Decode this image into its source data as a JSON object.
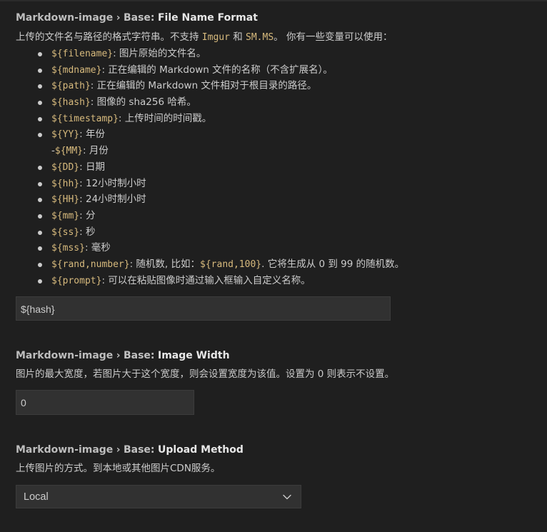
{
  "settings": [
    {
      "category": "Markdown-image",
      "separator": "›",
      "group": "Base:",
      "name": "File Name Format",
      "description_parts": [
        "上传的文件名与路径的格式字符串。不支持 ",
        "Imgur",
        " 和 ",
        "SM.MS",
        "。 你有一些变量可以使用："
      ],
      "variables": [
        {
          "code": "${filename}",
          "text": ": 图片原始的文件名。"
        },
        {
          "code": "${mdname}",
          "text": ": 正在编辑的 Markdown 文件的名称（不含扩展名）。"
        },
        {
          "code": "${path}",
          "text": ": 正在编辑的 Markdown 文件相对于根目录的路径。"
        },
        {
          "code": "${hash}",
          "text": ": 图像的 sha256 哈希。"
        },
        {
          "code": "${timestamp}",
          "text": ": 上传时间的时间戳。"
        },
        {
          "code": "${YY}",
          "text": ": 年份"
        },
        {
          "prefix": "-",
          "code": "${MM}",
          "text": ": 月份",
          "no_bullet": true
        },
        {
          "code": "${DD}",
          "text": ": 日期"
        },
        {
          "code": "${hh}",
          "text": ": 12小时制小时"
        },
        {
          "code": "${HH}",
          "text": ": 24小时制小时"
        },
        {
          "code": "${mm}",
          "text": ": 分"
        },
        {
          "code": "${ss}",
          "text": ": 秒"
        },
        {
          "code": "${mss}",
          "text": ": 毫秒"
        },
        {
          "code": "${rand,number}",
          "text": ": 随机数, 比如：",
          "code2": "${rand,100}",
          "text2": ". 它将生成从 0 到 99 的随机数。"
        },
        {
          "code": "${prompt}",
          "text": ": 可以在粘贴图像时通过输入框输入自定义名称。"
        }
      ],
      "value": "${hash}"
    },
    {
      "category": "Markdown-image",
      "separator": "›",
      "group": "Base:",
      "name": "Image Width",
      "description": "图片的最大宽度，若图片大于这个宽度，则会设置宽度为该值。设置为 0 则表示不设置。",
      "value": "0"
    },
    {
      "category": "Markdown-image",
      "separator": "›",
      "group": "Base:",
      "name": "Upload Method",
      "description": "上传图片的方式。到本地或其他图片CDN服务。",
      "value": "Local",
      "icon": "chevron-down-icon"
    }
  ]
}
